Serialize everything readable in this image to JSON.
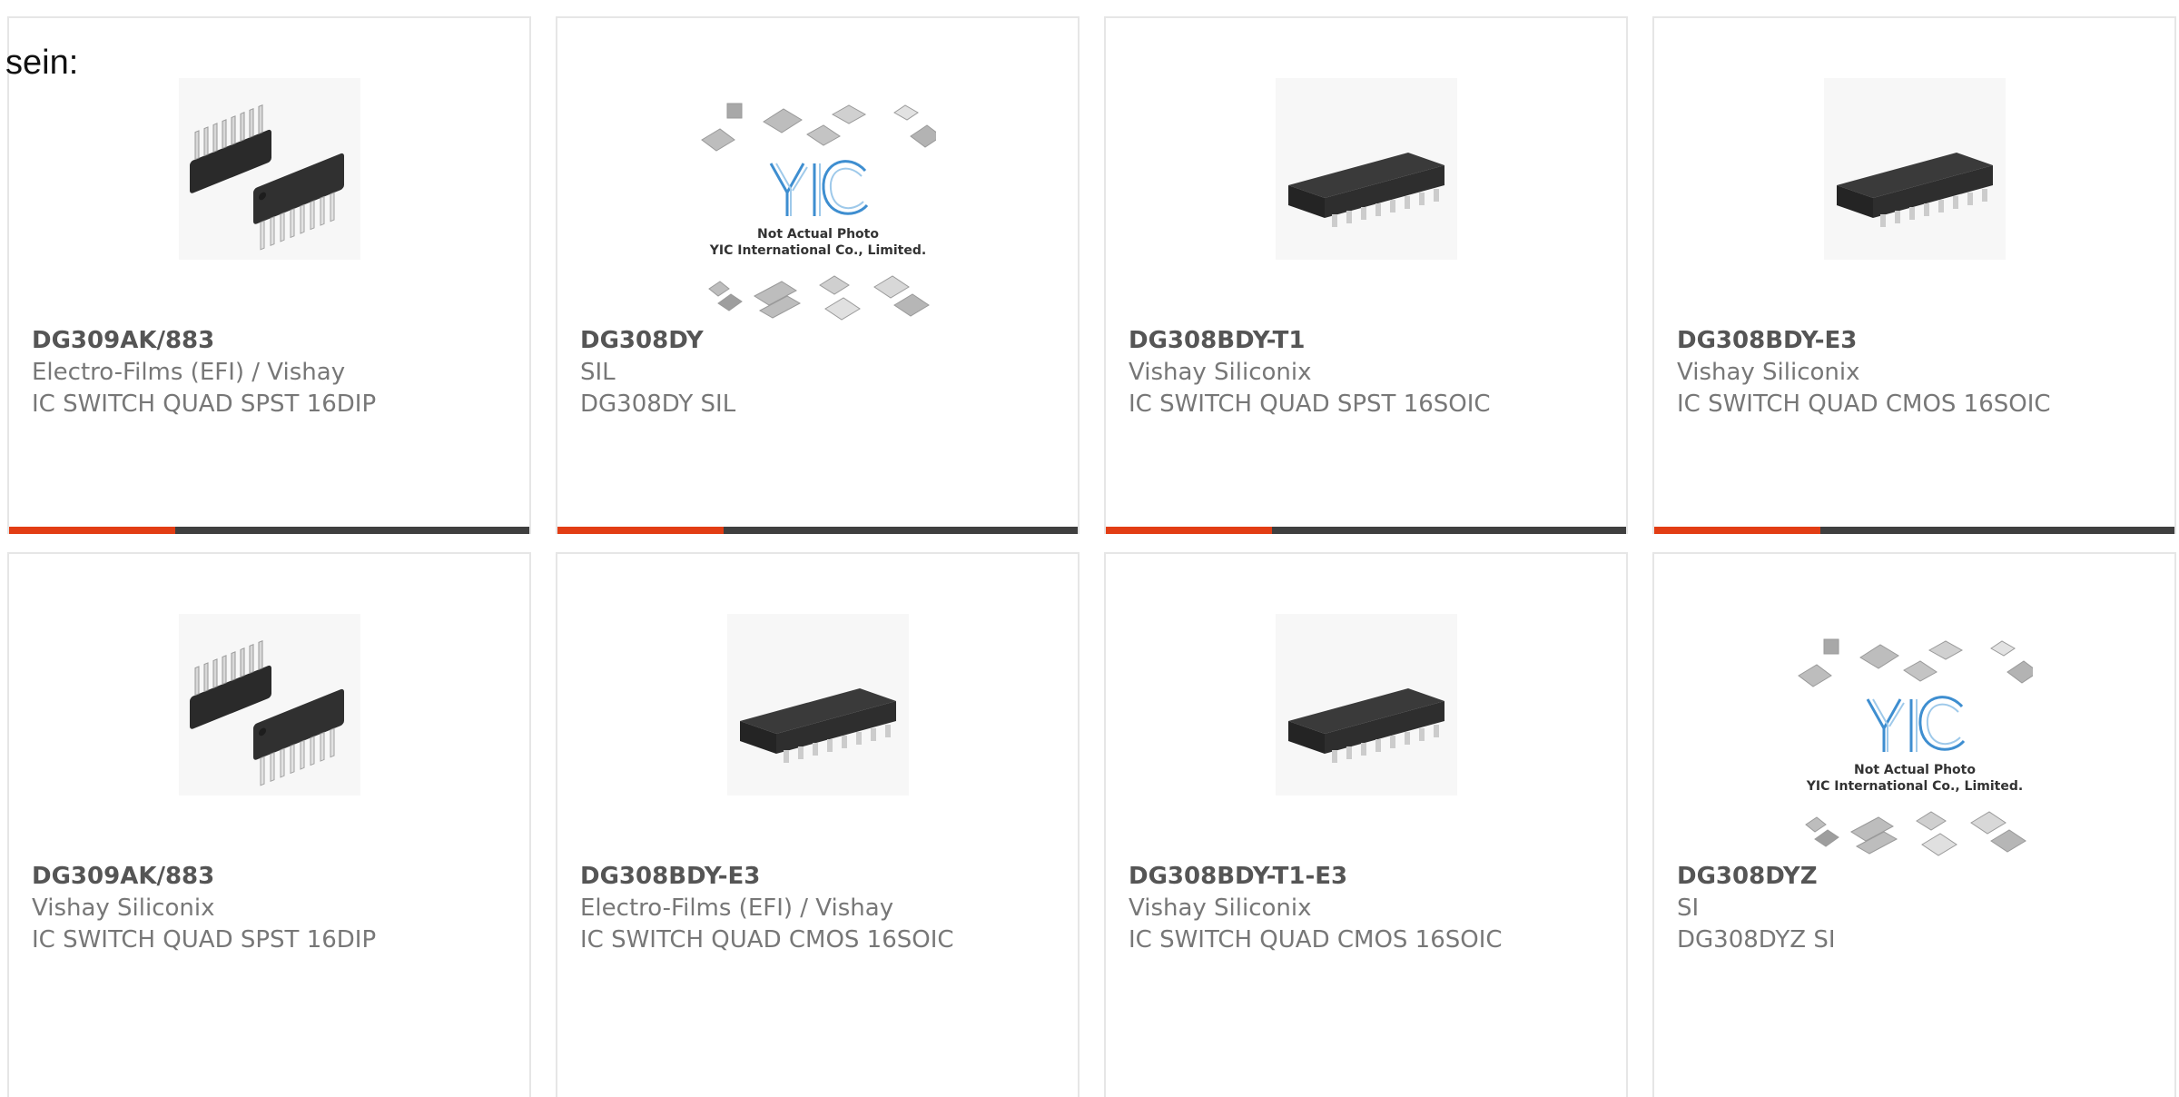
{
  "intro_text": "sein:",
  "colors": {
    "accent": "#e23d14",
    "bar_dark": "#3f3f3f",
    "border": "#e6e6e6",
    "part_number": "#555555",
    "body_text": "#777777"
  },
  "products": [
    {
      "part_number": "DG309AK/883",
      "manufacturer": "Electro-Films (EFI) / Vishay",
      "description": "IC SWITCH QUAD SPST 16DIP",
      "image": "dip16-chip-photo",
      "progress": 0.32
    },
    {
      "part_number": "DG308DY",
      "manufacturer": "SIL",
      "description": "DG308DY SIL",
      "image": "yic-placeholder-logo",
      "image_text": [
        "Not Actual Photo",
        "YIC International Co., Limited."
      ],
      "progress": 0.32
    },
    {
      "part_number": "DG308BDY-T1",
      "manufacturer": "Vishay Siliconix",
      "description": "IC SWITCH QUAD SPST 16SOIC",
      "image": "soic16-chip-photo",
      "progress": 0.32
    },
    {
      "part_number": "DG308BDY-E3",
      "manufacturer": "Vishay Siliconix",
      "description": "IC SWITCH QUAD CMOS 16SOIC",
      "image": "soic16-chip-photo",
      "progress": 0.32
    },
    {
      "part_number": "DG309AK/883",
      "manufacturer": "Vishay Siliconix",
      "description": "IC SWITCH QUAD SPST 16DIP",
      "image": "dip16-chip-photo"
    },
    {
      "part_number": "DG308BDY-E3",
      "manufacturer": "Electro-Films (EFI) / Vishay",
      "description": "IC SWITCH QUAD CMOS 16SOIC",
      "image": "soic16-chip-photo"
    },
    {
      "part_number": "DG308BDY-T1-E3",
      "manufacturer": "Vishay Siliconix",
      "description": "IC SWITCH QUAD CMOS 16SOIC",
      "image": "soic16-chip-photo"
    },
    {
      "part_number": "DG308DYZ",
      "manufacturer": "SI",
      "description": "DG308DYZ SI",
      "image": "yic-placeholder-logo",
      "image_text": [
        "Not Actual Photo",
        "YIC International Co., Limited."
      ]
    }
  ]
}
